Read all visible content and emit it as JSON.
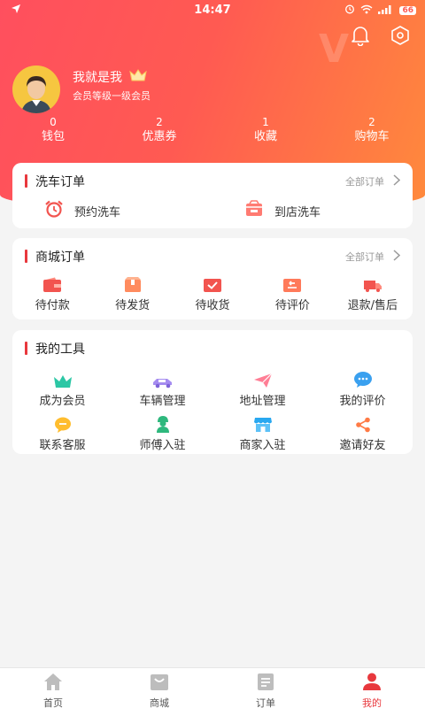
{
  "status": {
    "time": "14:47",
    "battery": "66"
  },
  "profile": {
    "name": "我就是我",
    "level": "会员等级一级会员"
  },
  "stats": [
    {
      "num": "0",
      "label": "钱包"
    },
    {
      "num": "2",
      "label": "优惠券"
    },
    {
      "num": "1",
      "label": "收藏"
    },
    {
      "num": "2",
      "label": "购物车"
    }
  ],
  "wash": {
    "title": "洗车订单",
    "more": "全部订单",
    "items": [
      {
        "label": "预约洗车",
        "icon": "alarm-clock-icon"
      },
      {
        "label": "到店洗车",
        "icon": "shop-icon"
      }
    ]
  },
  "mall": {
    "title": "商城订单",
    "more": "全部订单",
    "items": [
      {
        "label": "待付款",
        "icon": "wallet-icon"
      },
      {
        "label": "待发货",
        "icon": "package-icon"
      },
      {
        "label": "待收货",
        "icon": "box-check-icon"
      },
      {
        "label": "待评价",
        "icon": "review-icon"
      },
      {
        "label": "退款/售后",
        "icon": "truck-icon"
      }
    ]
  },
  "tools": {
    "title": "我的工具",
    "items": [
      {
        "label": "成为会员",
        "icon": "crown-icon"
      },
      {
        "label": "车辆管理",
        "icon": "car-icon"
      },
      {
        "label": "地址管理",
        "icon": "paper-plane-icon"
      },
      {
        "label": "我的评价",
        "icon": "chat-bubbles-icon"
      },
      {
        "label": "联系客服",
        "icon": "service-chat-icon"
      },
      {
        "label": "师傅入驻",
        "icon": "worker-icon"
      },
      {
        "label": "商家入驻",
        "icon": "store-icon"
      },
      {
        "label": "邀请好友",
        "icon": "share-icon"
      }
    ]
  },
  "tabs": [
    {
      "label": "首页",
      "icon": "home-icon"
    },
    {
      "label": "商城",
      "icon": "mall-icon"
    },
    {
      "label": "订单",
      "icon": "order-icon"
    },
    {
      "label": "我的",
      "icon": "profile-icon",
      "active": true
    }
  ],
  "colors": {
    "accent": "#e8383d",
    "gradient_start": "#ff4f5e",
    "gradient_end": "#ff8a3c"
  }
}
